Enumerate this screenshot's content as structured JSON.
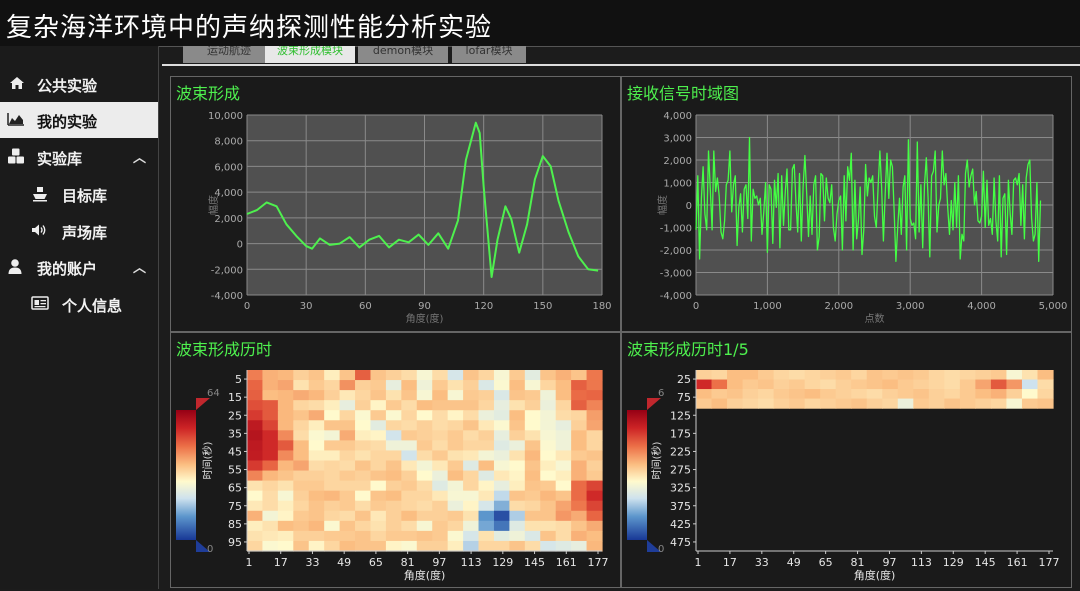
{
  "app": {
    "title": "复杂海洋环境中的声纳探测性能分析实验"
  },
  "sidebar": {
    "items": [
      {
        "label": "公共实验",
        "icon": "home-icon"
      },
      {
        "label": "我的实验",
        "icon": "area-chart-icon"
      },
      {
        "label": "实验库",
        "icon": "cubes-icon"
      },
      {
        "label": "目标库",
        "icon": "ship-icon"
      },
      {
        "label": "声场库",
        "icon": "speaker-icon"
      },
      {
        "label": "我的账户",
        "icon": "user-icon"
      },
      {
        "label": "个人信息",
        "icon": "id-card-icon"
      }
    ]
  },
  "tabs": [
    {
      "label": "运动航迹"
    },
    {
      "label": "波束形成模块"
    },
    {
      "label": "demon模块"
    },
    {
      "label": "lofar模块"
    }
  ],
  "panels": {
    "beam": {
      "title": "波束形成",
      "xlabel": "角度(度)",
      "ylabel": "幅度"
    },
    "time": {
      "title": "接收信号时域图",
      "xlabel": "点数",
      "ylabel": "幅度"
    },
    "hist": {
      "title": "波束形成历时",
      "xlabel": "角度(度)",
      "ylabel": "时间(秒)",
      "cbar_max": "64",
      "cbar_min": "0"
    },
    "hist5": {
      "title": "波束形成历时1/5",
      "xlabel": "角度(度)",
      "ylabel": "时间(秒)",
      "cbar_max": "6",
      "cbar_min": "0"
    }
  },
  "chart_data": [
    {
      "type": "line",
      "title": "波束形成",
      "xlabel": "角度(度)",
      "ylabel": "幅度",
      "xlim": [
        0,
        180
      ],
      "ylim": [
        -4000,
        10000
      ],
      "xticks": [
        "0",
        "30",
        "60",
        "90",
        "120",
        "150",
        "180"
      ],
      "yticks": [
        "10,000",
        "8,000",
        "6,000",
        "4,000",
        "2,000",
        "0",
        "-2,000",
        "-4,000"
      ],
      "series": [
        {
          "color": "#4ef04e",
          "x": [
            0,
            5,
            10,
            15,
            20,
            25,
            30,
            33,
            37,
            42,
            47,
            52,
            57,
            62,
            67,
            72,
            77,
            82,
            87,
            92,
            97,
            102,
            107,
            111,
            116,
            118,
            120,
            124,
            127,
            131,
            134,
            138,
            142,
            146,
            150,
            154,
            158,
            163,
            168,
            173,
            178
          ],
          "y": [
            2300,
            2600,
            3200,
            2900,
            1500,
            600,
            -200,
            -400,
            400,
            -100,
            0,
            500,
            -300,
            300,
            600,
            -300,
            300,
            100,
            700,
            -100,
            800,
            -400,
            1800,
            6500,
            9400,
            8600,
            4400,
            -2600,
            300,
            2900,
            1900,
            -700,
            1500,
            5000,
            6800,
            6000,
            3300,
            900,
            -1000,
            -2000,
            -2100
          ]
        }
      ]
    },
    {
      "type": "line",
      "title": "接收信号时域图",
      "xlabel": "点数",
      "ylabel": "幅度",
      "xlim": [
        0,
        5000
      ],
      "ylim": [
        -4000,
        4000
      ],
      "xticks": [
        "0",
        "1,000",
        "2,000",
        "3,000",
        "4,000",
        "5,000"
      ],
      "yticks": [
        "4,000",
        "3,000",
        "2,000",
        "1,000",
        "0",
        "-1,000",
        "-2,000",
        "-3,000",
        "-4,000"
      ],
      "series": [
        {
          "color": "#44ff44",
          "x_step": 25,
          "y": [
            -1100,
            1300,
            -2400,
            300,
            1700,
            -400,
            -1100,
            2400,
            700,
            -1100,
            2400,
            600,
            1200,
            400,
            -1200,
            -1500,
            -700,
            900,
            1100,
            2400,
            -300,
            900,
            1300,
            -1800,
            -100,
            500,
            -1200,
            700,
            900,
            -600,
            3000,
            -1600,
            700,
            300,
            400,
            0,
            300,
            -1300,
            -300,
            1000,
            -2100,
            900,
            700,
            -1700,
            1100,
            -100,
            1400,
            -1900,
            1300,
            -900,
            600,
            1600,
            -1100,
            -1100,
            1600,
            1800,
            100,
            -1200,
            1400,
            -1600,
            800,
            2200,
            500,
            -1400,
            400,
            -1300,
            900,
            1300,
            -2000,
            -1400,
            1400,
            1300,
            -700,
            1200,
            300,
            100,
            900,
            -1000,
            -1600,
            -400,
            200,
            400,
            -2000,
            1300,
            -700,
            1700,
            1100,
            2300,
            -2000,
            1100,
            -1500,
            -700,
            800,
            -2200,
            -1100,
            1800,
            400,
            1200,
            1000,
            1300,
            -500,
            -1000,
            800,
            2400,
            800,
            -1600,
            500,
            2300,
            300,
            2000,
            1700,
            -200,
            -2500,
            -1000,
            300,
            -1300,
            800,
            1300,
            -2000,
            2900,
            -600,
            -900,
            -800,
            -1500,
            2800,
            -1200,
            900,
            -1900,
            900,
            2100,
            300,
            -2300,
            1300,
            1500,
            2400,
            -1200,
            0,
            300,
            2400,
            900,
            1400,
            -100,
            -1300,
            200,
            -1100,
            1000,
            -1000,
            1300,
            -2400,
            -1300,
            -1600,
            1400,
            2000,
            800,
            1300,
            1600,
            0,
            600,
            -700,
            -800,
            -500,
            1500,
            -1000,
            1100,
            -900,
            -600,
            -1300,
            1200,
            -700,
            -1600,
            1300,
            -2300,
            300,
            500,
            -2200,
            1100,
            -400,
            -1300,
            1100,
            1200,
            900,
            1400,
            -900,
            900,
            -1500,
            1200,
            1800,
            2000,
            -600,
            -1600,
            -1300,
            1000,
            -2500,
            200
          ]
        }
      ]
    },
    {
      "type": "heatmap",
      "title": "波束形成历时",
      "xlabel": "角度(度)",
      "ylabel": "时间(秒)",
      "xticks": [
        "1",
        "17",
        "33",
        "49",
        "65",
        "81",
        "97",
        "113",
        "129",
        "145",
        "161",
        "177"
      ],
      "yticks": [
        "5",
        "15",
        "25",
        "35",
        "45",
        "55",
        "65",
        "75",
        "85",
        "95"
      ],
      "colorbar": {
        "max": 64,
        "min": 0
      },
      "cols": 23,
      "rows": 18,
      "values": [
        [
          70,
          62,
          61,
          57,
          59,
          52,
          59,
          75,
          59,
          57,
          55,
          48,
          55,
          40,
          59,
          56,
          48,
          58,
          43,
          59,
          62,
          59,
          71
        ],
        [
          74,
          62,
          64,
          54,
          58,
          56,
          67,
          57,
          58,
          44,
          60,
          46,
          58,
          54,
          57,
          41,
          49,
          60,
          48,
          56,
          60,
          75,
          71
        ],
        [
          75,
          60,
          61,
          63,
          61,
          57,
          53,
          56,
          59,
          54,
          59,
          48,
          60,
          48,
          58,
          57,
          41,
          59,
          58,
          46,
          60,
          73,
          74
        ],
        [
          78,
          76,
          61,
          56,
          55,
          52,
          44,
          57,
          51,
          58,
          55,
          60,
          59,
          59,
          59,
          56,
          44,
          54,
          57,
          45,
          56,
          75,
          69
        ],
        [
          82,
          76,
          61,
          59,
          63,
          50,
          56,
          49,
          58,
          49,
          56,
          50,
          55,
          51,
          55,
          45,
          43,
          60,
          50,
          47,
          55,
          56,
          65
        ],
        [
          90,
          80,
          61,
          56,
          52,
          59,
          59,
          50,
          43,
          56,
          55,
          57,
          55,
          56,
          59,
          53,
          49,
          59,
          50,
          47,
          44,
          57,
          64
        ],
        [
          92,
          85,
          68,
          55,
          49,
          47,
          63,
          52,
          51,
          39,
          58,
          57,
          56,
          58,
          55,
          57,
          44,
          57,
          54,
          48,
          46,
          60,
          56
        ],
        [
          90,
          85,
          76,
          60,
          50,
          58,
          58,
          56,
          55,
          46,
          46,
          58,
          55,
          58,
          56,
          56,
          42,
          45,
          59,
          49,
          46,
          60,
          56
        ],
        [
          89,
          85,
          68,
          60,
          52,
          52,
          56,
          54,
          56,
          56,
          39,
          55,
          58,
          54,
          53,
          47,
          45,
          54,
          61,
          50,
          53,
          58,
          59
        ],
        [
          82,
          74,
          61,
          64,
          55,
          56,
          55,
          59,
          56,
          59,
          53,
          47,
          53,
          58,
          42,
          60,
          48,
          50,
          59,
          52,
          48,
          62,
          57
        ],
        [
          69,
          61,
          59,
          57,
          57,
          56,
          58,
          57,
          59,
          60,
          57,
          50,
          45,
          60,
          56,
          42,
          53,
          51,
          60,
          50,
          52,
          62,
          58
        ],
        [
          54,
          56,
          54,
          58,
          58,
          56,
          56,
          56,
          50,
          57,
          58,
          55,
          42,
          47,
          56,
          51,
          44,
          52,
          59,
          58,
          50,
          73,
          80
        ],
        [
          50,
          55,
          48,
          57,
          60,
          61,
          58,
          50,
          59,
          60,
          56,
          56,
          53,
          48,
          48,
          53,
          36,
          59,
          58,
          61,
          59,
          73,
          85
        ],
        [
          53,
          55,
          52,
          56,
          59,
          57,
          58,
          55,
          58,
          57,
          56,
          55,
          57,
          45,
          51,
          40,
          26,
          55,
          56,
          59,
          64,
          71,
          80
        ],
        [
          62,
          47,
          51,
          58,
          59,
          56,
          55,
          59,
          53,
          57,
          60,
          57,
          57,
          58,
          54,
          20,
          5,
          33,
          59,
          59,
          66,
          63,
          74
        ],
        [
          52,
          54,
          60,
          59,
          61,
          49,
          59,
          56,
          54,
          57,
          55,
          48,
          58,
          56,
          46,
          24,
          13,
          42,
          54,
          54,
          55,
          59,
          63
        ],
        [
          54,
          53,
          52,
          57,
          57,
          58,
          58,
          59,
          56,
          58,
          58,
          59,
          58,
          49,
          40,
          54,
          43,
          46,
          41,
          59,
          55,
          62,
          60
        ],
        [
          56,
          49,
          50,
          59,
          51,
          56,
          60,
          59,
          59,
          51,
          49,
          57,
          57,
          52,
          34,
          56,
          56,
          59,
          55,
          40,
          42,
          44,
          61
        ]
      ]
    },
    {
      "type": "heatmap",
      "title": "波束形成历时1/5",
      "xlabel": "角度(度)",
      "ylabel": "时间(秒)",
      "xticks": [
        "1",
        "17",
        "33",
        "49",
        "65",
        "81",
        "97",
        "113",
        "129",
        "145",
        "161",
        "177"
      ],
      "yticks": [
        "25",
        "75",
        "125",
        "175",
        "225",
        "275",
        "325",
        "375",
        "425",
        "475"
      ],
      "colorbar": {
        "max": 6,
        "min": 0
      },
      "cols": 23,
      "rows": 4,
      "values": [
        [
          57,
          56,
          60,
          60,
          58,
          56,
          55,
          56,
          57,
          58,
          56,
          59,
          58,
          59,
          58,
          56,
          55,
          56,
          57,
          58,
          48,
          54,
          60
        ],
        [
          85,
          72,
          60,
          58,
          59,
          57,
          58,
          56,
          55,
          57,
          58,
          59,
          60,
          58,
          57,
          56,
          55,
          58,
          64,
          76,
          66,
          38,
          55
        ],
        [
          60,
          58,
          59,
          57,
          56,
          58,
          59,
          60,
          58,
          57,
          56,
          55,
          57,
          58,
          59,
          57,
          56,
          58,
          60,
          62,
          57,
          50,
          56
        ],
        [
          58,
          60,
          57,
          56,
          55,
          57,
          58,
          56,
          57,
          58,
          59,
          57,
          56,
          45,
          58,
          57,
          59,
          58,
          57,
          56,
          48,
          58,
          59
        ]
      ]
    }
  ]
}
